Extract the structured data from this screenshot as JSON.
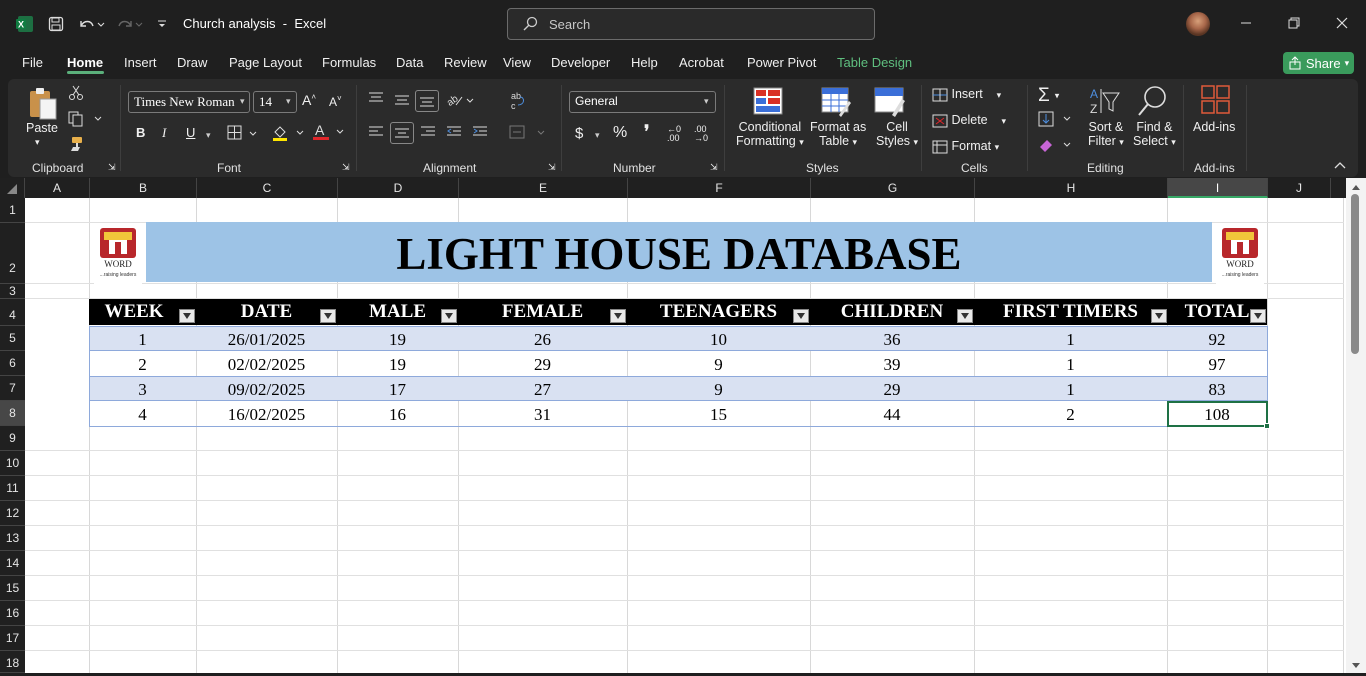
{
  "window": {
    "title": "Church analysis",
    "app_name": "Excel",
    "title_separator": "-",
    "search_placeholder": "Search"
  },
  "menu": {
    "items": [
      "File",
      "Home",
      "Insert",
      "Draw",
      "Page Layout",
      "Formulas",
      "Data",
      "Review",
      "View",
      "Developer",
      "Help",
      "Acrobat",
      "Power Pivot",
      "Table Design"
    ],
    "active": "Home",
    "share_label": "Share"
  },
  "ribbon": {
    "clipboard": {
      "label": "Clipboard",
      "paste": "Paste"
    },
    "font": {
      "label": "Font",
      "font_name": "Times New Roman",
      "font_size": "14"
    },
    "alignment": {
      "label": "Alignment"
    },
    "number": {
      "label": "Number",
      "format": "General"
    },
    "styles": {
      "label": "Styles",
      "conditional_1": "Conditional",
      "conditional_2": "Formatting",
      "format_table_1": "Format as",
      "format_table_2": "Table",
      "cell_styles_1": "Cell",
      "cell_styles_2": "Styles"
    },
    "cells": {
      "label": "Cells",
      "insert": "Insert",
      "delete": "Delete",
      "format": "Format"
    },
    "editing": {
      "label": "Editing",
      "sort_1": "Sort &",
      "sort_2": "Filter",
      "find_1": "Find &",
      "find_2": "Select"
    },
    "addins": {
      "label": "Add-ins",
      "button": "Add-ins"
    }
  },
  "sheet": {
    "columns": [
      "A",
      "B",
      "C",
      "D",
      "E",
      "F",
      "G",
      "H",
      "I",
      "J"
    ],
    "selected_column": "I",
    "rows": [
      "1",
      "2",
      "3",
      "4",
      "5",
      "6",
      "7",
      "8",
      "9",
      "10",
      "11",
      "12",
      "13",
      "14",
      "15",
      "16",
      "17",
      "18"
    ],
    "selected_row": "8",
    "banner_title": "LIGHT HOUSE DATABASE",
    "logo_text": "WORD",
    "logo_tagline": "...raising leaders",
    "table": {
      "headers": [
        "WEEK",
        "DATE",
        "MALE",
        "FEMALE",
        "TEENAGERS",
        "CHILDREN",
        "FIRST TIMERS",
        "TOTAL"
      ],
      "rows": [
        [
          "1",
          "26/01/2025",
          "19",
          "26",
          "10",
          "36",
          "1",
          "92"
        ],
        [
          "2",
          "02/02/2025",
          "19",
          "29",
          "9",
          "39",
          "1",
          "97"
        ],
        [
          "3",
          "09/02/2025",
          "17",
          "27",
          "9",
          "29",
          "1",
          "83"
        ],
        [
          "4",
          "16/02/2025",
          "16",
          "31",
          "15",
          "44",
          "2",
          "108"
        ]
      ]
    }
  },
  "colors": {
    "accent_green": "#37a866",
    "banner_fill": "#9dc3e6",
    "band_fill": "#d9e1f2",
    "header_fill": "#000000"
  }
}
